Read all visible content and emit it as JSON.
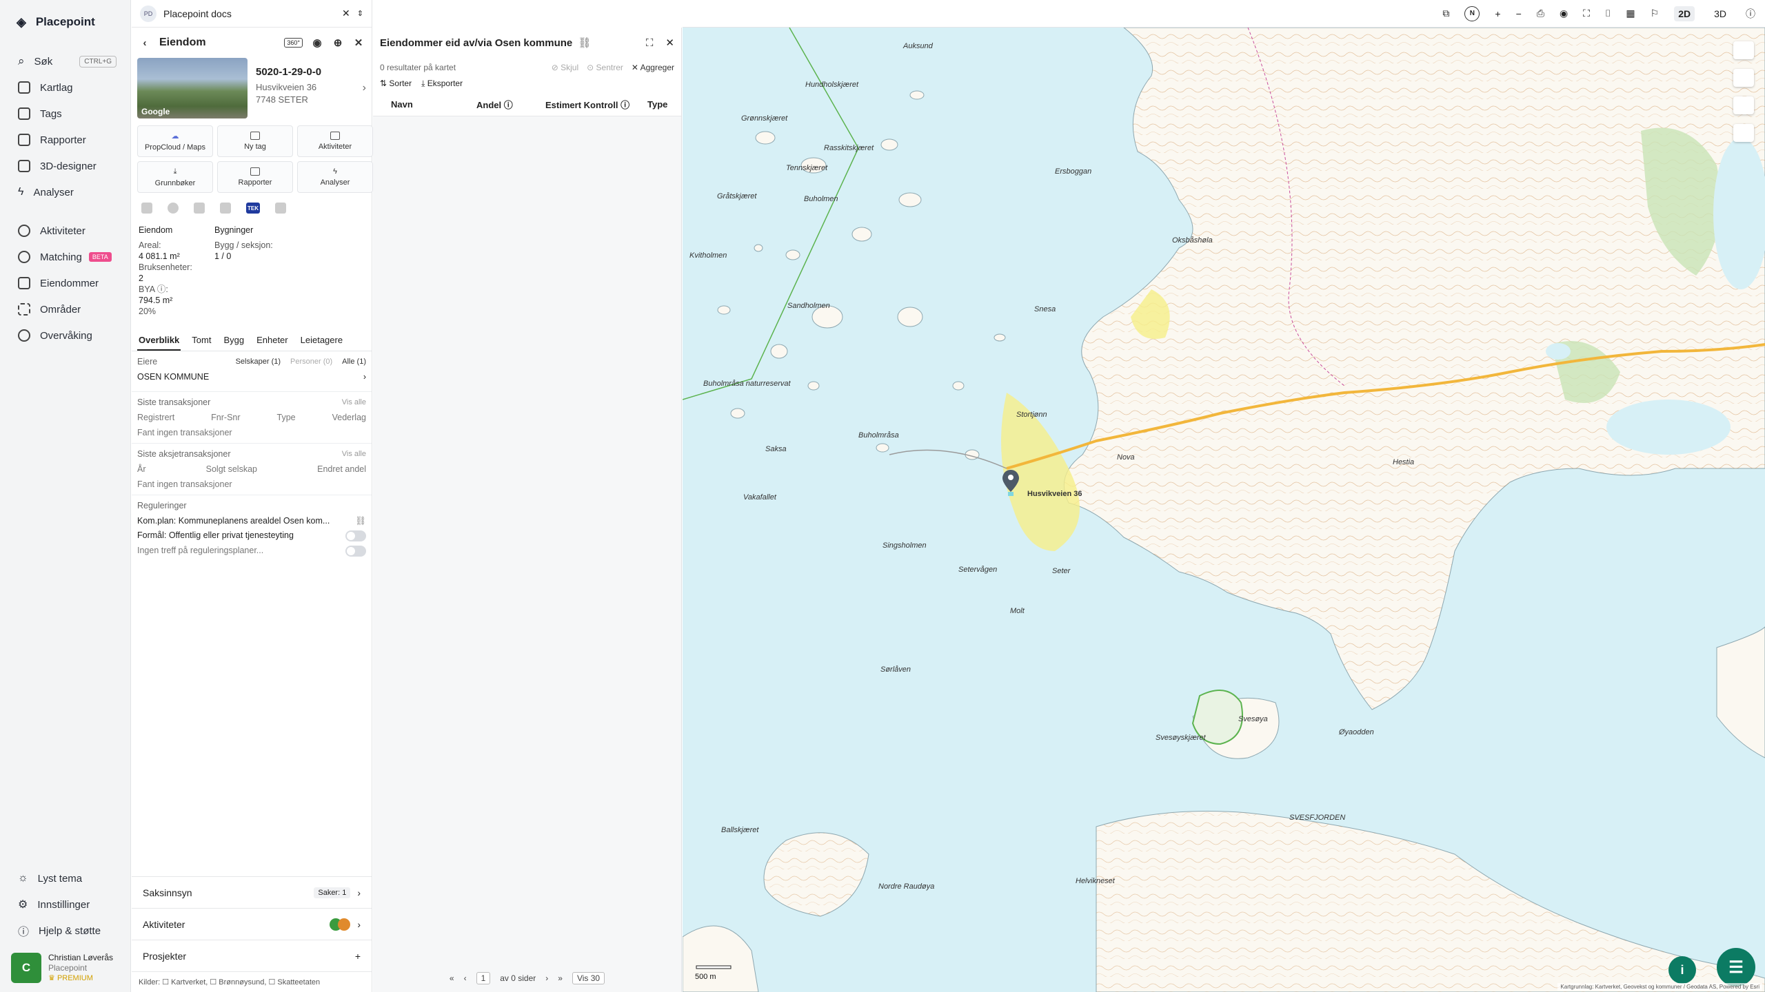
{
  "app": {
    "name": "Placepoint"
  },
  "nav": {
    "items": [
      {
        "label": "Søk",
        "shortcut": "CTRL+G"
      },
      {
        "label": "Kartlag"
      },
      {
        "label": "Tags"
      },
      {
        "label": "Rapporter"
      },
      {
        "label": "3D-designer"
      },
      {
        "label": "Analyser"
      },
      {
        "label": "Aktiviteter"
      },
      {
        "label": "Matching",
        "badge": "BETA"
      },
      {
        "label": "Eiendommer"
      },
      {
        "label": "Områder"
      },
      {
        "label": "Overvåking"
      }
    ],
    "bottom": [
      {
        "label": "Lyst tema"
      },
      {
        "label": "Innstillinger"
      },
      {
        "label": "Hjelp & støtte"
      }
    ],
    "user": {
      "initial": "C",
      "name": "Christian Løverås",
      "org": "Placepoint",
      "plan": "PREMIUM"
    }
  },
  "workspace": {
    "badge": "PD",
    "name": "Placepoint docs"
  },
  "property": {
    "panel_title": "Eiendom",
    "id_badge": "360°",
    "photo_credit": "Google",
    "matrikkel": "5020-1-29-0-0",
    "address_line1": "Husvikveien 36",
    "address_line2": "7748 SETER",
    "actions": [
      "PropCloud / Maps",
      "Ny tag",
      "Aktiviteter",
      "Grunnbøker",
      "Rapporter",
      "Analyser"
    ],
    "source_tek": "TEK",
    "summary": {
      "eiendom_title": "Eiendom",
      "bygninger_title": "Bygninger",
      "areal_label": "Areal:",
      "areal_value": "4 081.1 m²",
      "bygg_label": "Bygg / seksjon:",
      "bygg_value": "1 / 0",
      "bruks_label": "Bruksenheter:",
      "bruks_value": "2",
      "bya_label": "BYA ⓘ:",
      "bya_value": "794.5 m²",
      "bya_pct": "20%"
    },
    "tabs": [
      "Overblikk",
      "Tomt",
      "Bygg",
      "Enheter",
      "Leietagere"
    ],
    "owners": {
      "label": "Eiere",
      "filters": [
        "Selskaper (1)",
        "Personer (0)",
        "Alle (1)"
      ],
      "name": "OSEN KOMMUNE"
    },
    "transactions": {
      "title": "Siste transaksjoner",
      "view_all": "Vis alle",
      "cols": [
        "Registrert",
        "Fnr-Snr",
        "Type",
        "Vederlag"
      ],
      "empty": "Fant ingen transaksjoner"
    },
    "share_transactions": {
      "title": "Siste aksjetransaksjoner",
      "view_all": "Vis alle",
      "cols": [
        "År",
        "Solgt selskap",
        "Endret andel"
      ],
      "empty": "Fant ingen transaksjoner"
    },
    "regulations": {
      "title": "Reguleringer",
      "plan": "Kom.plan: Kommuneplanens arealdel Osen kom...",
      "purpose": "Formål: Offentlig eller privat tjenesteyting",
      "none": "Ingen treff på reguleringsplaner..."
    },
    "accordion": [
      {
        "label": "Saksinnsyn",
        "meta": "Saker: 1"
      },
      {
        "label": "Aktiviteter"
      },
      {
        "label": "Prosjekter"
      }
    ],
    "sources": "Kilder: ☐ Kartverket, ☐ Brønnøysund, ☐ Skatteetaten"
  },
  "results": {
    "title": "Eiendommer eid av/via Osen kommune",
    "count_text": "0 resultater på kartet",
    "actions": [
      "Skjul",
      "Sentrer",
      "Aggreger"
    ],
    "tools": [
      "Sorter",
      "Eksporter"
    ],
    "columns": [
      "Navn",
      "Andel ⓘ",
      "Estimert Kontroll ⓘ",
      "Type"
    ],
    "pager": {
      "page": "1",
      "of_text": "av 0 sider",
      "per_page": "Vis 30"
    }
  },
  "map": {
    "modes": [
      "2D",
      "3D"
    ],
    "scale": "500 m",
    "marker_label": "Husvikveien 36",
    "place_names": [
      "Grønnskjæret",
      "Hundholskjæret",
      "Rasskitskjæret",
      "Tennskjæret",
      "Ersboggan",
      "Buholmen",
      "Gråtskjæret",
      "Kvitholmen",
      "Sandholmen",
      "Saksa",
      "Vakafallet",
      "Singsholmen",
      "Setervågen",
      "Seter",
      "Molt",
      "Sørlåven",
      "Svesøyskjæret",
      "Svesøya",
      "Øyaodden",
      "Ballskjæret",
      "Nordre Raudøya",
      "Helvikneset",
      "Oksbåshøla",
      "Snesa",
      "Stortjønn",
      "Nova",
      "Hestia",
      "Buholmråsa",
      "Auksund",
      "SVESFJORDEN",
      "Buholmråsa naturreservat"
    ],
    "attribution": "Kartgrunnlag: Kartverket, Geovekst og kommuner / Geodata AS, Powered by Esri",
    "colors": {
      "sea": "#d7f0f6",
      "land": "#fbf8f1",
      "wetland": "#e9f3e3",
      "contour": "#d39a62",
      "road": "#f2b63b",
      "reserve": "#5cb34f"
    }
  }
}
